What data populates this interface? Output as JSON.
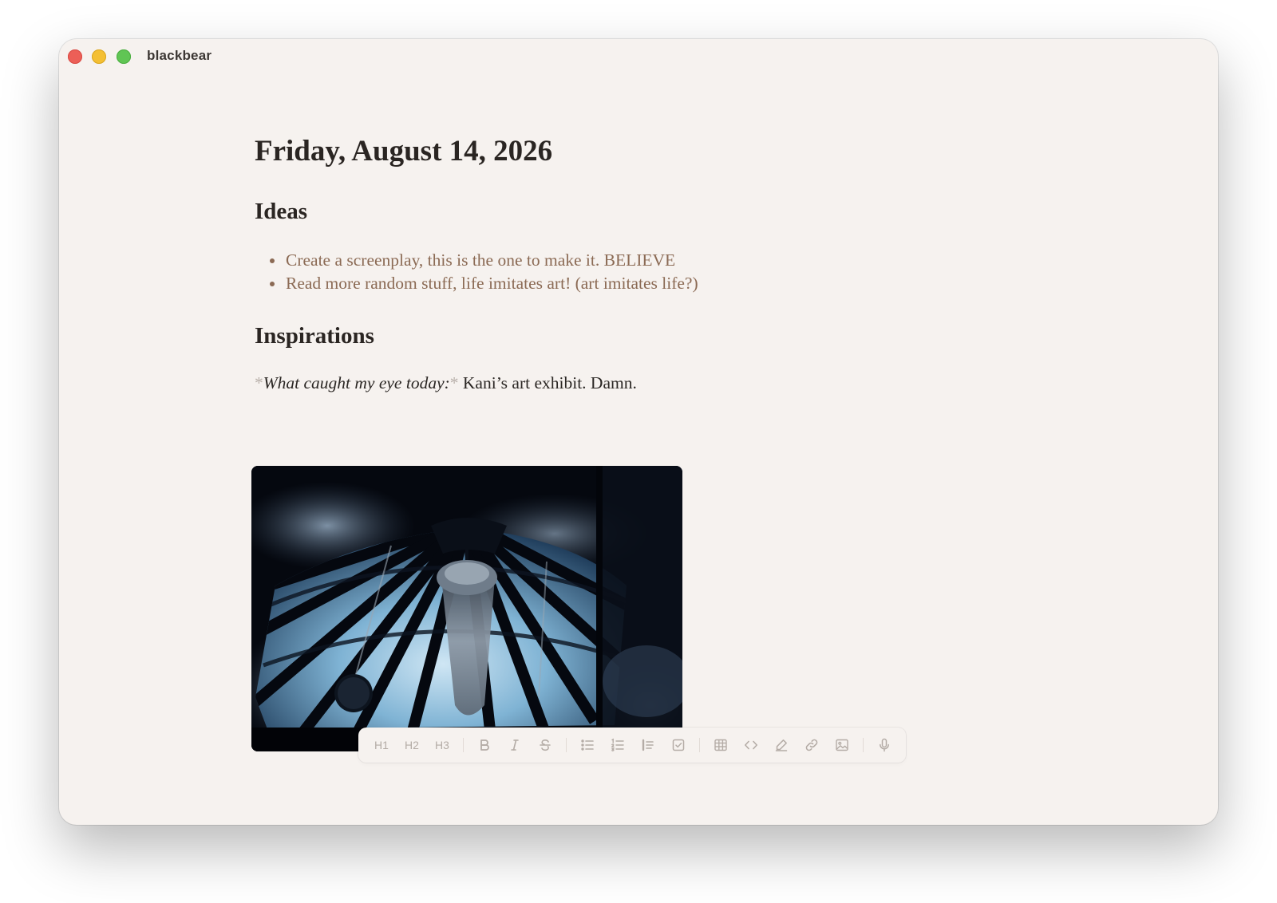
{
  "window": {
    "app_title": "blackbear"
  },
  "document": {
    "title": "Friday, August 14, 2026",
    "sections": {
      "ideas": {
        "heading": "Ideas",
        "items": [
          "Create a screenplay, this is the one to make it. BELIEVE",
          "Read more random stuff, life imitates art! (art imitates life?)"
        ]
      },
      "inspirations": {
        "heading": "Inspirations",
        "emphasis_marker": "*",
        "emphasis_text": "What caught my eye today:",
        "body_text": " Kani’s art exhibit. Damn."
      }
    },
    "image": {
      "description_icon": "photo-glass-dome-chandelier"
    }
  },
  "toolbar": {
    "h1_label": "H1",
    "h2_label": "H2",
    "h3_label": "H3",
    "icons": [
      "bold-icon",
      "italic-icon",
      "strikethrough-icon",
      "bullet-list-icon",
      "numbered-list-icon",
      "blockquote-icon",
      "checkbox-icon",
      "table-icon",
      "code-icon",
      "highlight-icon",
      "link-icon",
      "image-icon",
      "microphone-icon"
    ]
  }
}
